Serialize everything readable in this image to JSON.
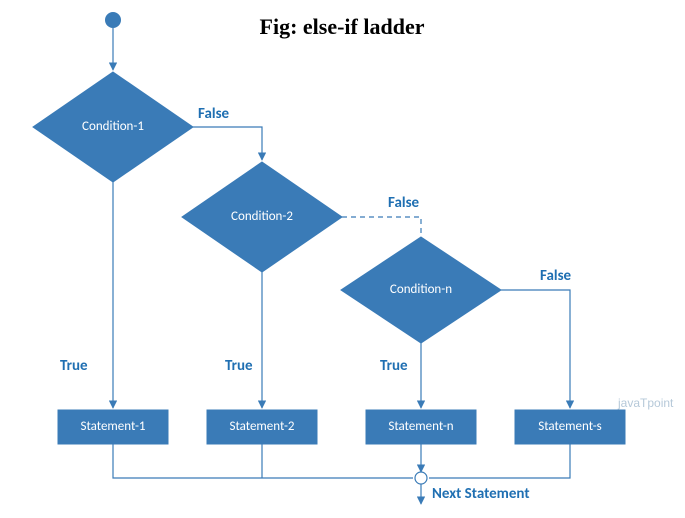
{
  "title": "Fig: else-if ladder",
  "watermark": "javaTpoint",
  "conditions": {
    "c1": "Condition-1",
    "c2": "Condition-2",
    "cn": "Condition-n"
  },
  "statements": {
    "s1": "Statement-1",
    "s2": "Statement-2",
    "sn": "Statement-n",
    "ss": "Statement-s"
  },
  "labels": {
    "true": "True",
    "false": "False",
    "next": "Next Statement"
  },
  "chart_data": {
    "type": "flowchart",
    "title": "else-if ladder",
    "nodes": [
      {
        "id": "start",
        "type": "start"
      },
      {
        "id": "c1",
        "type": "decision",
        "label": "Condition-1"
      },
      {
        "id": "c2",
        "type": "decision",
        "label": "Condition-2"
      },
      {
        "id": "cn",
        "type": "decision",
        "label": "Condition-n"
      },
      {
        "id": "s1",
        "type": "process",
        "label": "Statement-1"
      },
      {
        "id": "s2",
        "type": "process",
        "label": "Statement-2"
      },
      {
        "id": "sn",
        "type": "process",
        "label": "Statement-n"
      },
      {
        "id": "ss",
        "type": "process",
        "label": "Statement-s"
      },
      {
        "id": "next",
        "type": "connector",
        "label": "Next Statement"
      }
    ],
    "edges": [
      {
        "from": "start",
        "to": "c1"
      },
      {
        "from": "c1",
        "to": "s1",
        "label": "True"
      },
      {
        "from": "c1",
        "to": "c2",
        "label": "False"
      },
      {
        "from": "c2",
        "to": "s2",
        "label": "True"
      },
      {
        "from": "c2",
        "to": "cn",
        "label": "False",
        "style": "dashed"
      },
      {
        "from": "cn",
        "to": "sn",
        "label": "True"
      },
      {
        "from": "cn",
        "to": "ss",
        "label": "False"
      },
      {
        "from": "s1",
        "to": "next"
      },
      {
        "from": "s2",
        "to": "next"
      },
      {
        "from": "sn",
        "to": "next"
      },
      {
        "from": "ss",
        "to": "next"
      }
    ]
  }
}
